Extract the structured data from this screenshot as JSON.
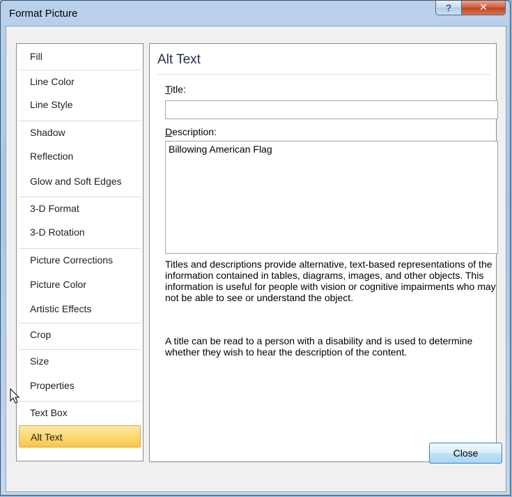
{
  "window": {
    "title": "Format Picture",
    "help_glyph": "?",
    "close_glyph": "✕"
  },
  "sidebar": {
    "items": [
      {
        "label": "Fill"
      },
      {
        "label": "Line Color"
      },
      {
        "label": "Line Style"
      },
      {
        "label": "Shadow"
      },
      {
        "label": "Reflection"
      },
      {
        "label": "Glow and Soft Edges"
      },
      {
        "label": "3-D Format"
      },
      {
        "label": "3-D Rotation"
      },
      {
        "label": "Picture Corrections"
      },
      {
        "label": "Picture Color"
      },
      {
        "label": "Artistic Effects"
      },
      {
        "label": "Crop"
      },
      {
        "label": "Size"
      },
      {
        "label": "Properties"
      },
      {
        "label": "Text Box"
      },
      {
        "label": "Alt Text"
      }
    ],
    "selected": "Alt Text"
  },
  "panel": {
    "heading": "Alt Text",
    "title_label_accel": "T",
    "title_label_rest": "itle:",
    "title_value": "",
    "description_label_accel": "D",
    "description_label_rest": "escription:",
    "description_value": "Billowing American Flag",
    "help_paragraph_1": "Titles and descriptions provide alternative, text-based representations of the information contained in tables, diagrams, images, and other objects. This information is useful for people with vision or cognitive impairments who may not be able to see or understand the object.",
    "help_paragraph_2": "A title can be read to a person with a disability and is used to determine whether they wish to hear the description of the content."
  },
  "footer": {
    "close_label": "Close"
  },
  "colors": {
    "selected_bg": "#fcd66a",
    "title_close_bg": "#c3421f",
    "heading_text": "#1e2e48"
  },
  "icons": {
    "cursor": "arrow-pointer-icon"
  }
}
